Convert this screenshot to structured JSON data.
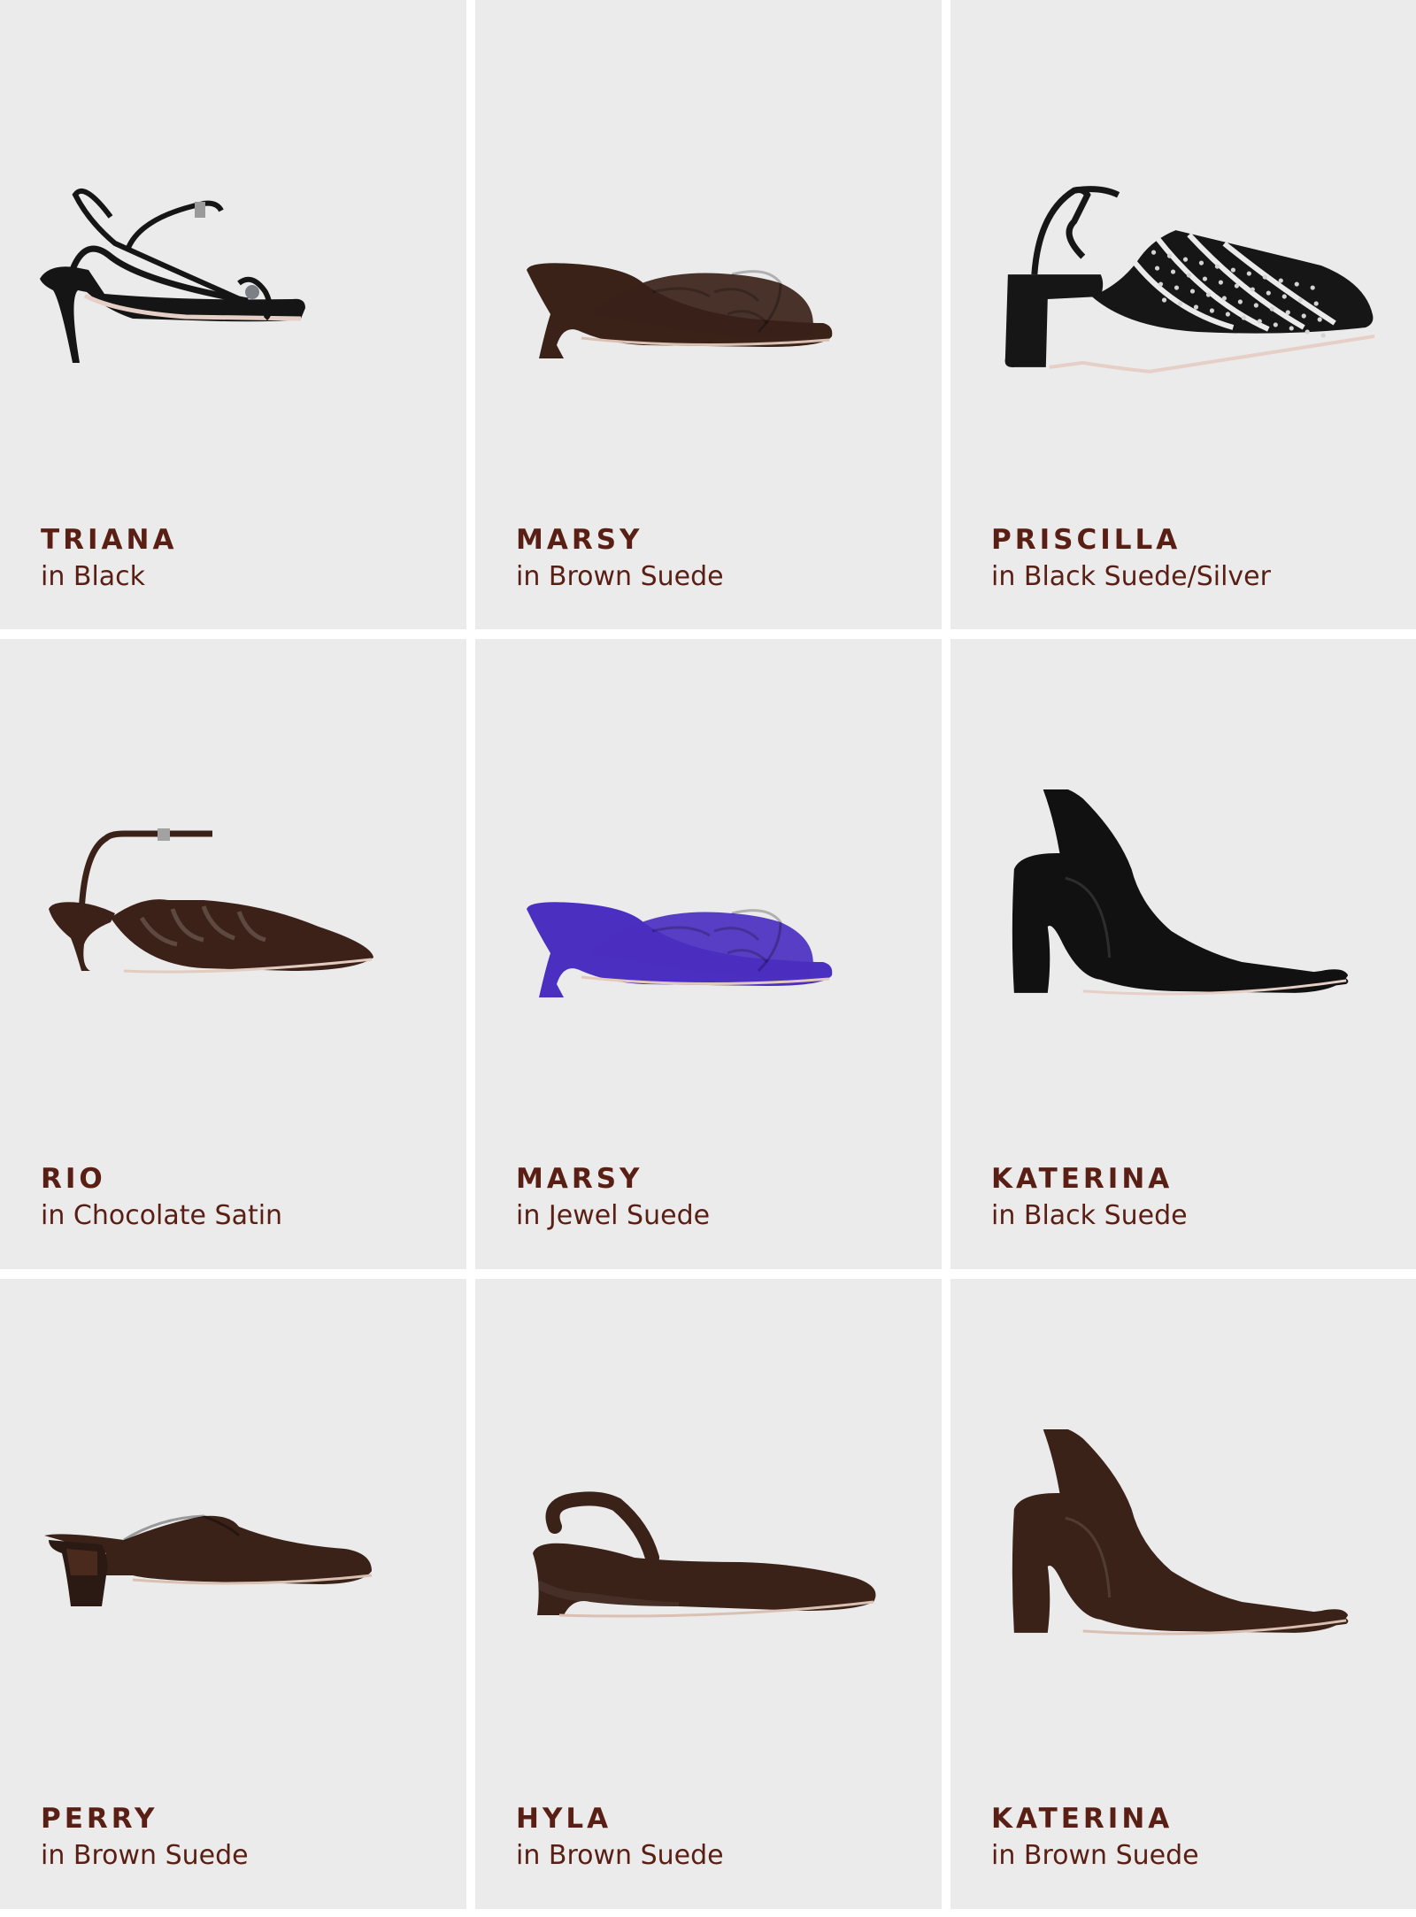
{
  "products": [
    {
      "name": "TRIANA",
      "variant": "in Black",
      "color": "#151515",
      "sole": "#e6cfc6",
      "icon": "strappy-sandal-icon",
      "style": "sandal"
    },
    {
      "name": "MARSY",
      "variant": "in Brown Suede",
      "color": "#3a2219",
      "sole": "#d9c0b3",
      "icon": "knot-wedge-mule-icon",
      "style": "wedge-mule"
    },
    {
      "name": "PRISCILLA",
      "variant": "in Black Suede/Silver",
      "color": "#161616",
      "sole": "#e6cfc6",
      "icon": "studded-slingback-icon",
      "style": "studded"
    },
    {
      "name": "RIO",
      "variant": "in Chocolate Satin",
      "color": "#3b2118",
      "sole": "#e2cbbf",
      "icon": "satin-kitten-heel-icon",
      "style": "kitten"
    },
    {
      "name": "MARSY",
      "variant": "in Jewel Suede",
      "color": "#4b2fc0",
      "sole": "#e3c9bd",
      "icon": "knot-wedge-mule-icon",
      "style": "wedge-mule"
    },
    {
      "name": "KATERINA",
      "variant": "in Black Suede",
      "color": "#111111",
      "sole": "#e6cfc6",
      "icon": "slingback-pump-icon",
      "style": "slingback"
    },
    {
      "name": "PERRY",
      "variant": "in Brown Suede",
      "color": "#3a2219",
      "sole": "#d9c0b3",
      "icon": "block-heel-mule-icon",
      "style": "mule"
    },
    {
      "name": "HYLA",
      "variant": "in Brown Suede",
      "color": "#3a2219",
      "sole": "#d9c0b3",
      "icon": "wedge-slingback-icon",
      "style": "wedge-slingback"
    },
    {
      "name": "KATERINA",
      "variant": "in Brown Suede",
      "color": "#3a2219",
      "sole": "#d9c0b3",
      "icon": "slingback-pump-icon",
      "style": "slingback"
    }
  ]
}
